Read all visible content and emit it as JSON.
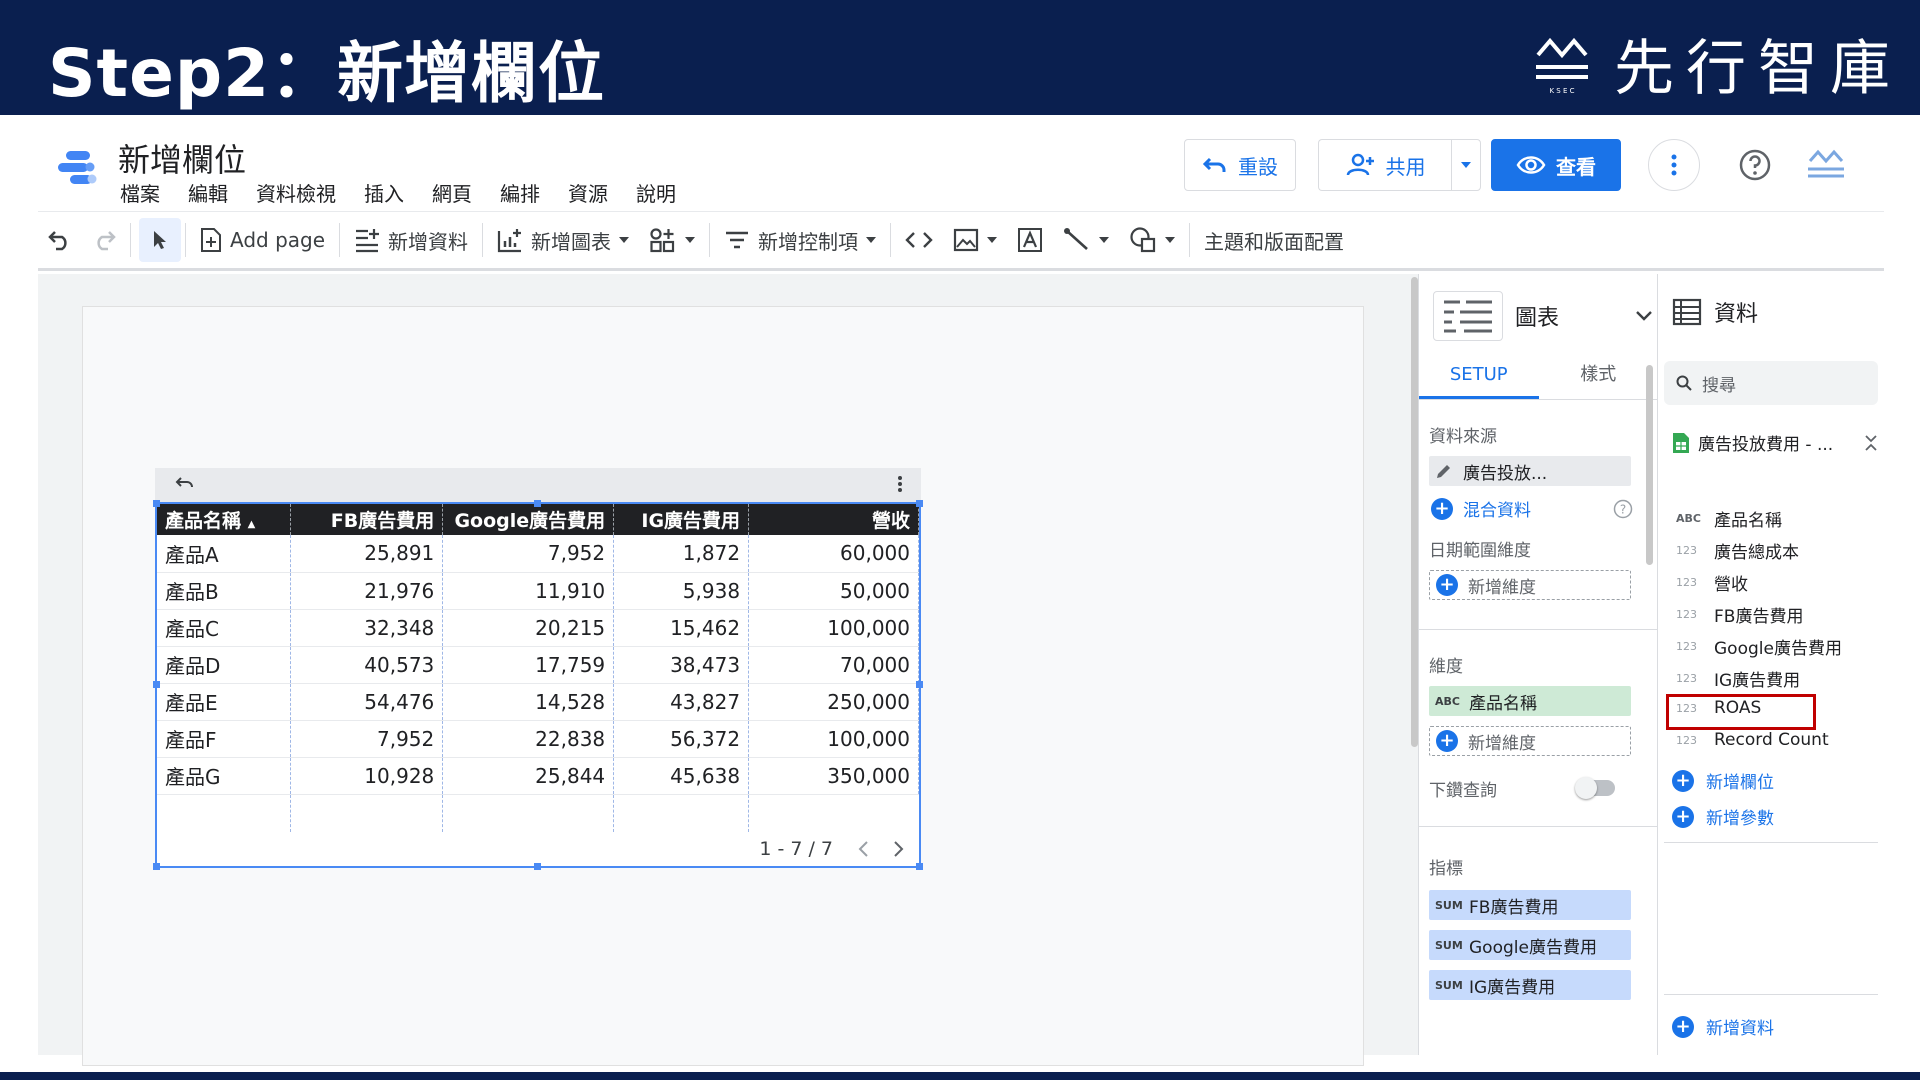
{
  "slide": {
    "title": "Step2：新增欄位",
    "brand_name": "先行智庫",
    "brand_sub": "K S E C"
  },
  "header": {
    "doc_title": "新增欄位",
    "menu": [
      "檔案",
      "編輯",
      "資料檢視",
      "插入",
      "網頁",
      "編排",
      "資源",
      "說明"
    ],
    "reset_label": "重設",
    "share_label": "共用",
    "view_label": "查看"
  },
  "toolbar": {
    "add_page": "Add page",
    "add_data": "新增資料",
    "add_chart": "新增圖表",
    "add_control": "新增控制項",
    "theme": "主題和版面配置"
  },
  "table": {
    "headers": [
      "產品名稱",
      "FB廣告費用",
      "Google廣告費用",
      "IG廣告費用",
      "營收"
    ],
    "rows": [
      [
        "產品A",
        "25,891",
        "7,952",
        "1,872",
        "60,000"
      ],
      [
        "產品B",
        "21,976",
        "11,910",
        "5,938",
        "50,000"
      ],
      [
        "產品C",
        "32,348",
        "20,215",
        "15,462",
        "100,000"
      ],
      [
        "產品D",
        "40,573",
        "17,759",
        "38,473",
        "70,000"
      ],
      [
        "產品E",
        "54,476",
        "14,528",
        "43,827",
        "250,000"
      ],
      [
        "產品F",
        "7,952",
        "22,838",
        "56,372",
        "100,000"
      ],
      [
        "產品G",
        "10,928",
        "25,844",
        "45,638",
        "350,000"
      ]
    ],
    "pager": "1 - 7 / 7"
  },
  "props": {
    "chart_label": "圖表",
    "tab_setup": "SETUP",
    "tab_style": "樣式",
    "datasource_title": "資料來源",
    "datasource_name": "廣告投放...",
    "blend_label": "混合資料",
    "date_range_title": "日期範圍維度",
    "add_dimension": "新增維度",
    "dimension_title": "維度",
    "dimension_tag": "ABC",
    "dimension_value": "產品名稱",
    "add_dimension2": "新增維度",
    "drilldown_title": "下鑽查詢",
    "metric_title": "指標",
    "metric_tag": "SUM",
    "metrics": [
      "FB廣告費用",
      "Google廣告費用",
      "IG廣告費用"
    ]
  },
  "data_panel": {
    "title": "資料",
    "search_placeholder": "搜尋",
    "source_name": "廣告投放費用 - ...",
    "fields": [
      {
        "type": "ABC",
        "name": "產品名稱"
      },
      {
        "type": "123",
        "name": "廣告總成本"
      },
      {
        "type": "123",
        "name": "營收"
      },
      {
        "type": "123",
        "name": "FB廣告費用"
      },
      {
        "type": "123",
        "name": "Google廣告費用"
      },
      {
        "type": "123",
        "name": "IG廣告費用"
      },
      {
        "type": "123",
        "name": "ROAS"
      },
      {
        "type": "123",
        "name": "Record Count"
      }
    ],
    "add_field": "新增欄位",
    "add_param": "新增參數",
    "add_data": "新增資料"
  },
  "colors": {
    "slide_bg": "#0a1f4f",
    "accent": "#1a73e8",
    "highlight": "#c00000"
  }
}
